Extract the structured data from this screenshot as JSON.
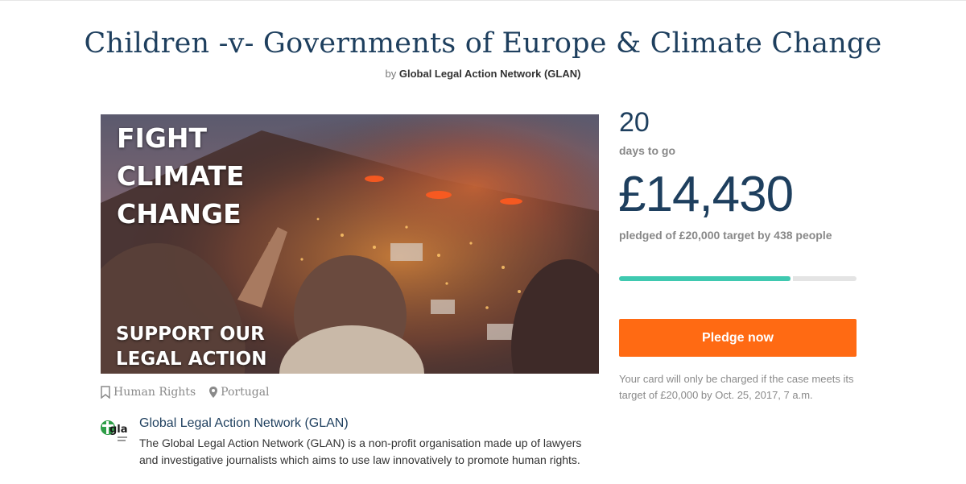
{
  "page": {
    "title": "Children -v- Governments of Europe & Climate Change",
    "by_prefix": "by",
    "author": "Global Legal Action Network (GLAN)"
  },
  "hero": {
    "headline_lines": [
      "FIGHT",
      "CLIMATE",
      "CHANGE"
    ],
    "tagline_lines": [
      "SUPPORT OUR",
      "LEGAL ACTION"
    ]
  },
  "tags": [
    {
      "icon": "bookmark-icon",
      "label": "Human Rights"
    },
    {
      "icon": "map-pin-icon",
      "label": "Portugal"
    }
  ],
  "organisation": {
    "logo_text": "gla",
    "name": "Global Legal Action Network (GLAN)",
    "description": "The Global Legal Action Network (GLAN) is a non-profit organisation made up of lawyers and investigative journalists which aims to use law innovatively to promote human rights."
  },
  "stats": {
    "days_left": "20",
    "days_label": "days to go",
    "amount": "£14,430",
    "pledged_text": "pledged of £20,000 target by 438 people",
    "progress_fraction": 0.7215
  },
  "cta": {
    "label": "Pledge now",
    "note": "Your card will only be charged if the case meets its target of £20,000 by Oct. 25, 2017, 7 a.m."
  },
  "colors": {
    "title": "#1e3f5e",
    "accent_button": "#ff6a13",
    "progress_fill": "#3fc9b0",
    "progress_track": "#e4e4e4"
  }
}
